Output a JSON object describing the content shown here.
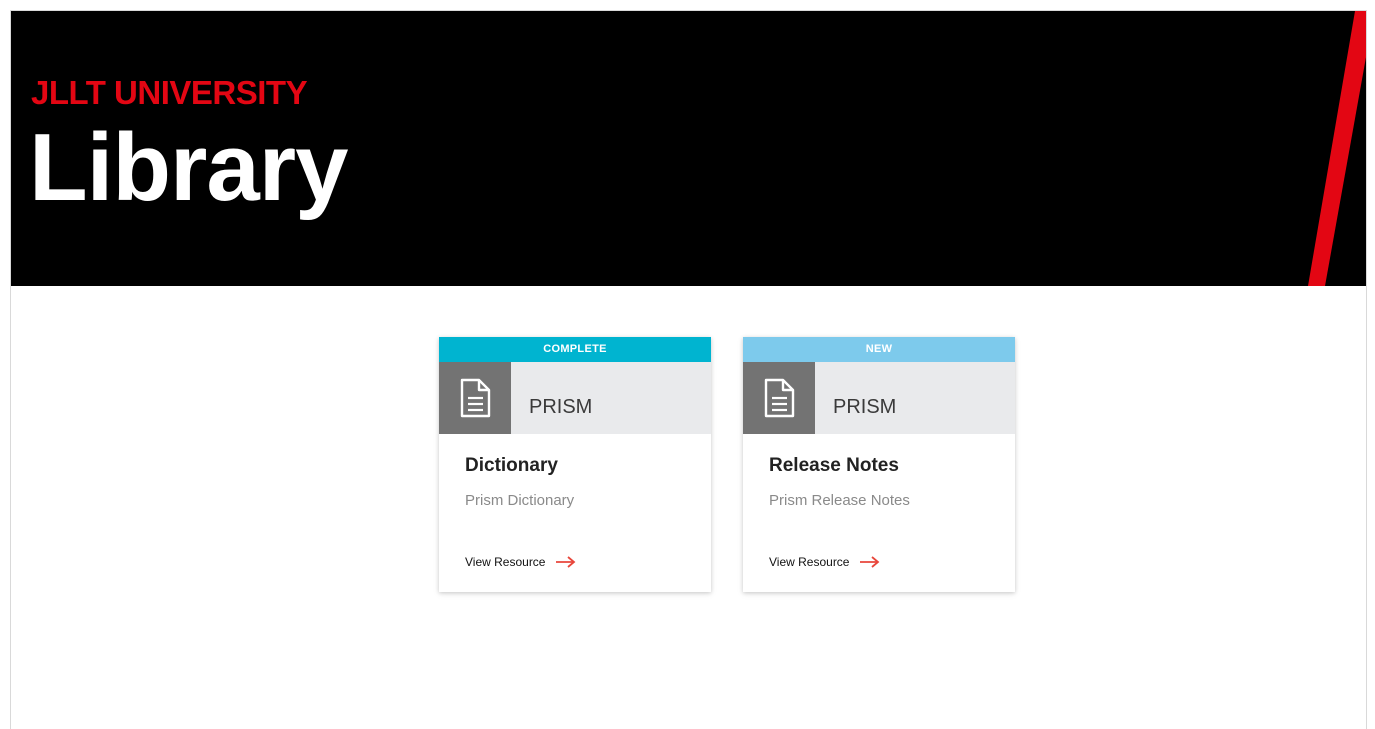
{
  "hero": {
    "kicker": "JLLT UNIVERSITY",
    "title": "Library"
  },
  "colors": {
    "hero_background": "#000000",
    "brand_red": "#e30613",
    "status_complete": "#00b4d0",
    "status_new": "#7dcaec",
    "link_arrow": "#e8463b"
  },
  "cards": [
    {
      "status": "COMPLETE",
      "category": "PRISM",
      "icon": "document-icon",
      "title": "Dictionary",
      "description": "Prism Dictionary",
      "link_label": "View Resource"
    },
    {
      "status": "NEW",
      "category": "PRISM",
      "icon": "document-icon",
      "title": "Release Notes",
      "description": "Prism Release Notes",
      "link_label": "View Resource"
    }
  ]
}
